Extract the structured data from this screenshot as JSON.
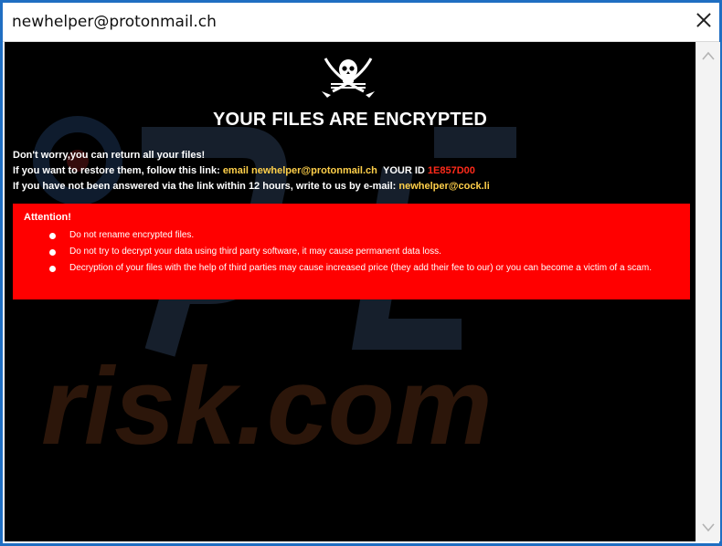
{
  "window": {
    "title": "newhelper@protonmail.ch"
  },
  "note": {
    "icon": "skull-crossbones-icon",
    "headline": "YOUR FILES ARE ENCRYPTED",
    "line1": "Don't worry,you can return all your files!",
    "line2_prefix": "If you want to restore them, follow this link:",
    "line2_email": "email newhelper@protonmail.ch",
    "line2_id_label": "YOUR ID",
    "line2_id": "1E857D00",
    "line3_prefix": "If you have not been answered via the link within 12 hours, write to us by e-mail:",
    "line3_email": "newhelper@cock.li"
  },
  "attention": {
    "title": "Attention!",
    "items": [
      "Do not rename encrypted files.",
      "Do not try to decrypt your data using third party software, it may cause permanent data loss.",
      "Decryption of your files with the help of third parties may cause increased price (they add their fee to our) or you can become a victim of a scam."
    ]
  },
  "watermark": {
    "text": "risk.com"
  },
  "colors": {
    "background": "#000000",
    "attention_bg": "#ff0000",
    "highlight": "#ffd04a",
    "id_color": "#ff2a1a",
    "frame": "#1f6ec2"
  }
}
